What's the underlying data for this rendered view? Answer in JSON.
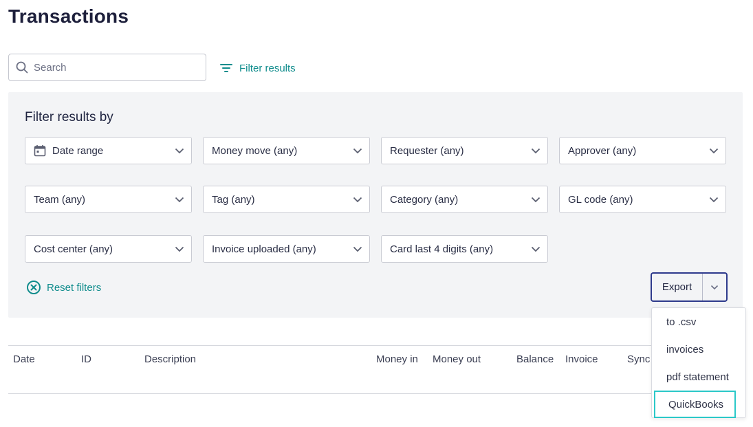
{
  "page": {
    "title": "Transactions"
  },
  "search": {
    "placeholder": "Search",
    "value": "",
    "icon": "search-icon"
  },
  "filter_toggle": {
    "label": "Filter results",
    "icon": "filter-lines-icon"
  },
  "filter_panel": {
    "title": "Filter results by",
    "dropdowns": [
      {
        "label": "Date range",
        "icon": "calendar-icon"
      },
      {
        "label": "Money move (any)"
      },
      {
        "label": "Requester (any)"
      },
      {
        "label": "Approver (any)"
      },
      {
        "label": "Team (any)"
      },
      {
        "label": "Tag (any)"
      },
      {
        "label": "Category (any)"
      },
      {
        "label": "GL code (any)"
      },
      {
        "label": "Cost center (any)"
      },
      {
        "label": "Invoice uploaded (any)"
      },
      {
        "label": "Card last 4 digits (any)"
      }
    ],
    "reset_label": "Reset filters"
  },
  "export": {
    "label": "Export",
    "menu": [
      "to .csv",
      "invoices",
      "pdf statement",
      "QuickBooks"
    ],
    "highlighted": "QuickBooks"
  },
  "table": {
    "columns": [
      "Date",
      "ID",
      "Description",
      "Money in",
      "Money out",
      "Balance",
      "Invoice",
      "Sync"
    ]
  },
  "colors": {
    "accent": "#0f8c8c",
    "export_border": "#2e3a8c",
    "highlight": "#2bc8c8",
    "panel_bg": "#f3f4f6"
  }
}
